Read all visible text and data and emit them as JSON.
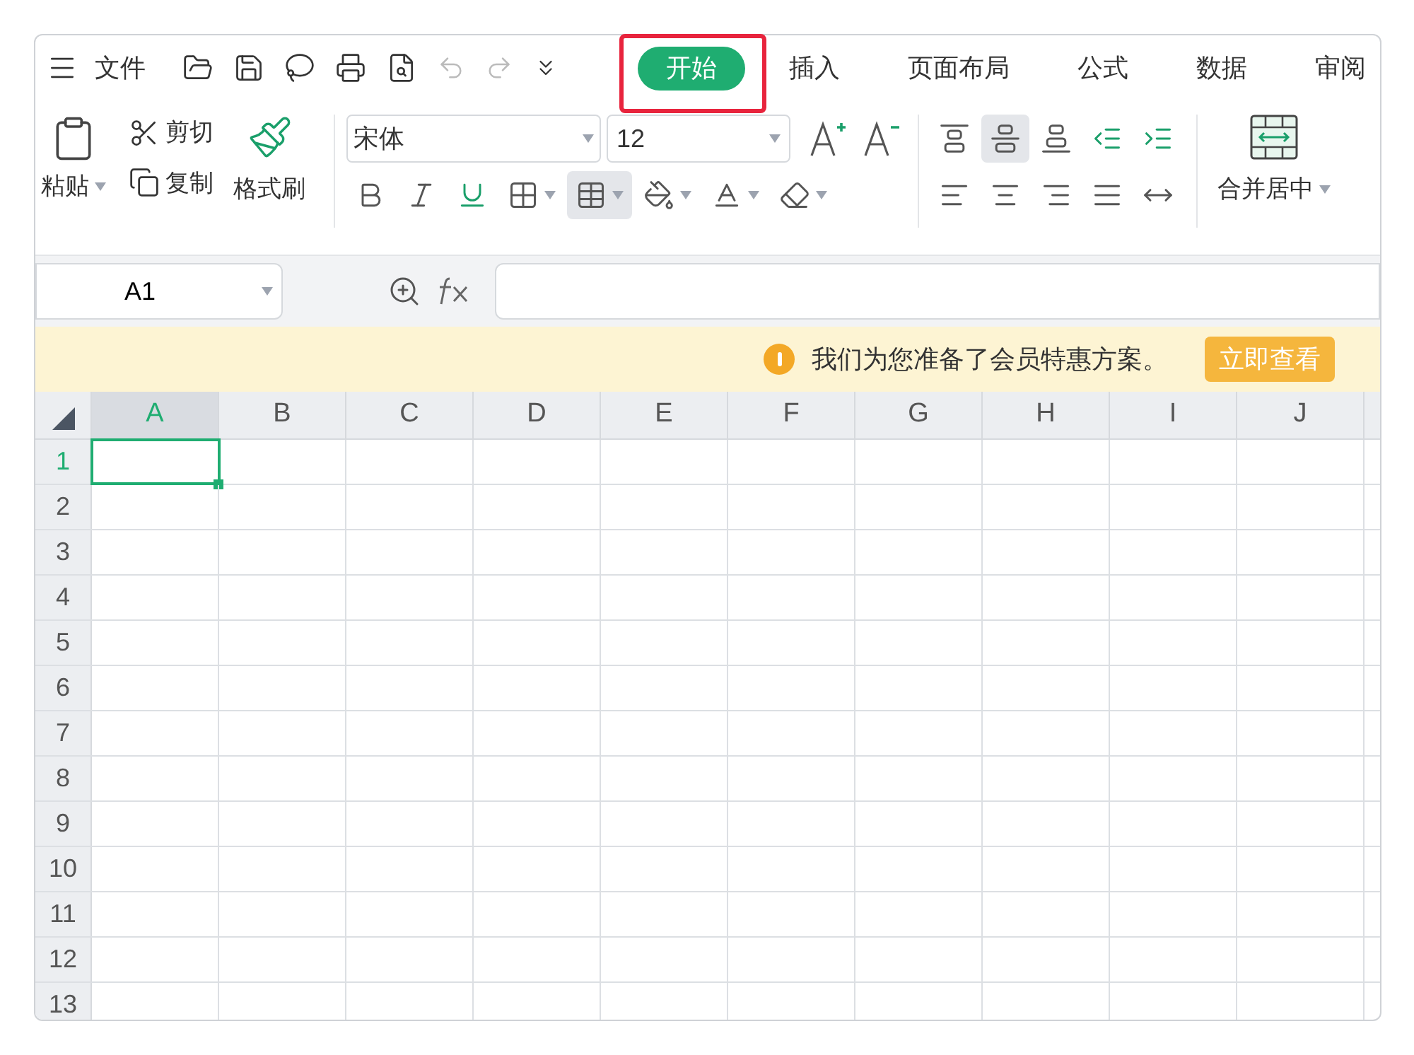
{
  "menu": {
    "label": "文件"
  },
  "tabs": [
    {
      "label": "开始",
      "selected": true
    },
    {
      "label": "插入",
      "selected": false
    },
    {
      "label": "页面布局",
      "selected": false
    },
    {
      "label": "公式",
      "selected": false
    },
    {
      "label": "数据",
      "selected": false
    },
    {
      "label": "审阅",
      "selected": false
    }
  ],
  "clipboard": {
    "paste": "粘贴",
    "cut": "剪切",
    "copy": "复制",
    "format_painter": "格式刷"
  },
  "font": {
    "name": "宋体",
    "size": "12"
  },
  "format_buttons": [
    {
      "kind": "bold",
      "selected": false
    },
    {
      "kind": "italic",
      "selected": false
    },
    {
      "kind": "underline",
      "selected": false
    },
    {
      "kind": "border",
      "selected": false
    },
    {
      "kind": "table-style",
      "selected": true
    },
    {
      "kind": "fill",
      "selected": false
    },
    {
      "kind": "font-color",
      "selected": false
    },
    {
      "kind": "eraser",
      "selected": false
    }
  ],
  "align_buttons": [
    {
      "kind": "top",
      "selected": false
    },
    {
      "kind": "middle",
      "selected": true
    },
    {
      "kind": "bottom",
      "selected": false
    },
    {
      "kind": "outdent",
      "selected": false
    },
    {
      "kind": "indent",
      "selected": false
    },
    {
      "kind": "left",
      "selected": false
    },
    {
      "kind": "center",
      "selected": false
    },
    {
      "kind": "right",
      "selected": false
    },
    {
      "kind": "justify",
      "selected": false
    },
    {
      "kind": "distribute",
      "selected": false
    }
  ],
  "merge": {
    "label": "合并居中"
  },
  "name_box": "A1",
  "notice": {
    "text": "我们为您准备了会员特惠方案。",
    "button": "立即查看"
  },
  "columns": [
    {
      "label": "A",
      "selected": true
    },
    {
      "label": "B",
      "selected": false
    },
    {
      "label": "C",
      "selected": false
    },
    {
      "label": "D",
      "selected": false
    },
    {
      "label": "E",
      "selected": false
    },
    {
      "label": "F",
      "selected": false
    },
    {
      "label": "G",
      "selected": false
    },
    {
      "label": "H",
      "selected": false
    },
    {
      "label": "I",
      "selected": false
    },
    {
      "label": "J",
      "selected": false
    }
  ],
  "rows": [
    {
      "label": "1",
      "selected": true
    },
    {
      "label": "2",
      "selected": false
    },
    {
      "label": "3",
      "selected": false
    },
    {
      "label": "4",
      "selected": false
    },
    {
      "label": "5",
      "selected": false
    },
    {
      "label": "6",
      "selected": false
    },
    {
      "label": "7",
      "selected": false
    },
    {
      "label": "8",
      "selected": false
    },
    {
      "label": "9",
      "selected": false
    },
    {
      "label": "10",
      "selected": false
    },
    {
      "label": "11",
      "selected": false
    },
    {
      "label": "12",
      "selected": false
    },
    {
      "label": "13",
      "selected": false
    }
  ]
}
